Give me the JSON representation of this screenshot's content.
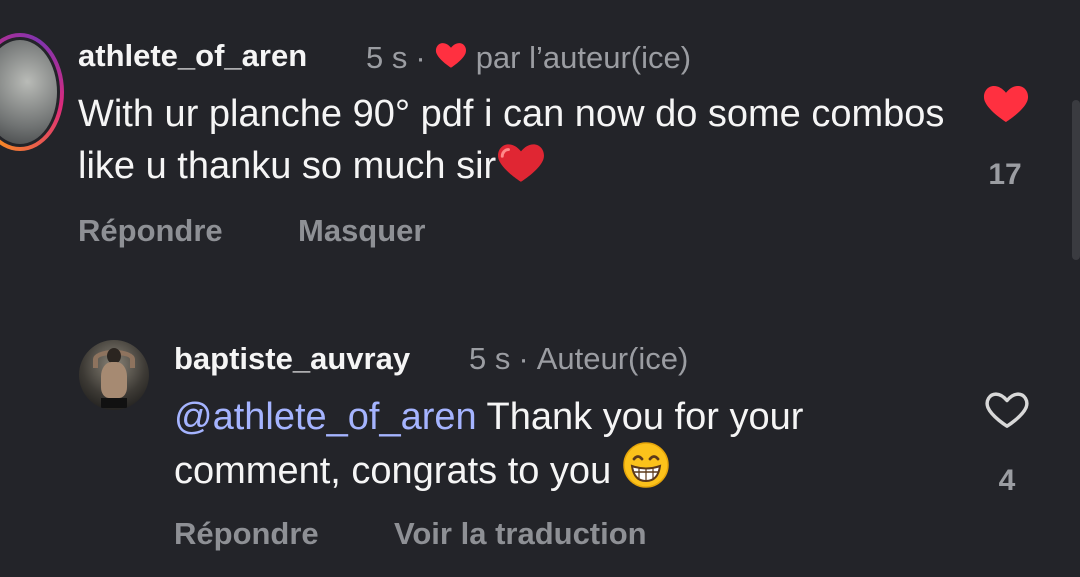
{
  "comments": [
    {
      "username": "athlete_of_aren",
      "time": "5 s",
      "separator": "·",
      "liked_by_author_label": "par l’auteur(ice)",
      "text": "With ur planche 90° pdf i can now do some combos like u thanku so much sir",
      "like_count": "17",
      "liked": true,
      "actions": {
        "reply": "Répondre",
        "hide": "Masquer"
      },
      "avatar_icon": "avatar-with-story-ring"
    },
    {
      "username": "baptiste_auvray",
      "time": "5 s",
      "separator": "·",
      "author_badge": "Auteur(ice)",
      "mention": "@athlete_of_aren",
      "text": " Thank you for your comment, congrats to you ",
      "like_count": "4",
      "liked": false,
      "actions": {
        "reply": "Répondre",
        "translate": "Voir la traduction"
      },
      "avatar_icon": "avatar"
    }
  ],
  "colors": {
    "background": "#232429",
    "heart_red": "#ff3040",
    "mention_blue": "#a5b4ff",
    "muted": "#9b9da2"
  }
}
